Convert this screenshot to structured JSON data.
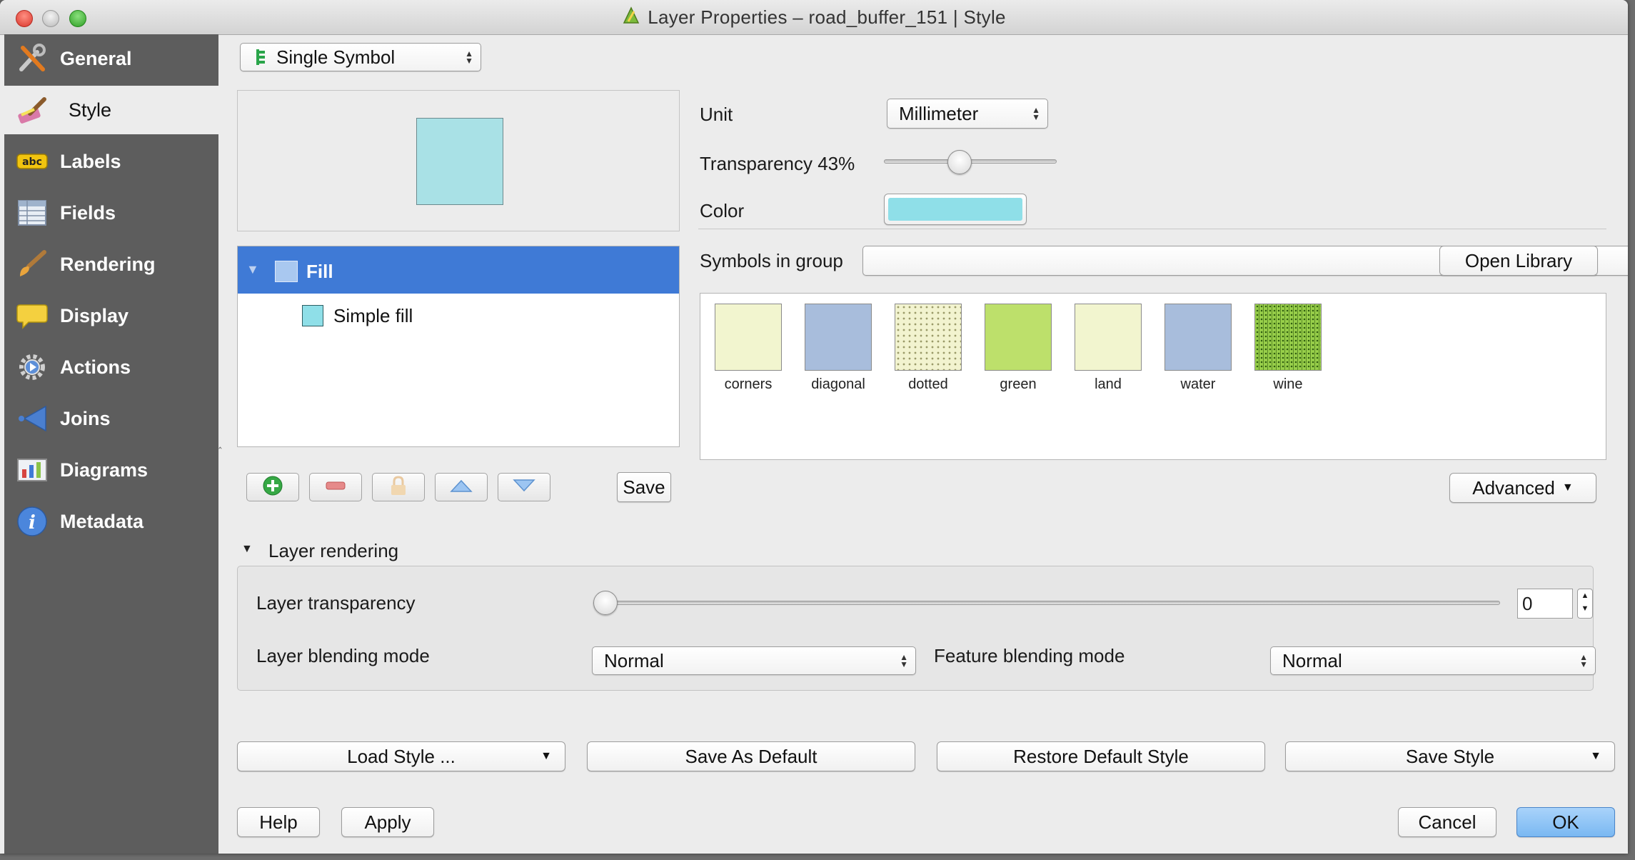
{
  "window": {
    "title": "Layer Properties – road_buffer_151 | Style"
  },
  "sidebar": {
    "items": [
      {
        "label": "General",
        "icon": "general-tools-icon"
      },
      {
        "label": "Style",
        "icon": "style-paintbrush-icon",
        "active": true
      },
      {
        "label": "Labels",
        "icon": "labels-abc-icon",
        "badge": "abc"
      },
      {
        "label": "Fields",
        "icon": "fields-table-icon"
      },
      {
        "label": "Rendering",
        "icon": "rendering-brush-icon"
      },
      {
        "label": "Display",
        "icon": "display-speech-bubble-icon"
      },
      {
        "label": "Actions",
        "icon": "actions-gear-icon"
      },
      {
        "label": "Joins",
        "icon": "joins-arrow-icon"
      },
      {
        "label": "Diagrams",
        "icon": "diagrams-icon"
      },
      {
        "label": "Metadata",
        "icon": "metadata-info-icon",
        "badge": "i"
      }
    ]
  },
  "renderer": {
    "selected": "Single Symbol"
  },
  "symbol_tree": {
    "fill_label": "Fill",
    "simple_fill_label": "Simple fill"
  },
  "tree_toolbar": {
    "save_label": "Save"
  },
  "symbol_props": {
    "unit_label": "Unit",
    "unit_value": "Millimeter",
    "transparency_label": "Transparency 43%",
    "transparency_value": 0.43,
    "color_label": "Color",
    "color_value": "#8fdfe8"
  },
  "library": {
    "group_label": "Symbols in group",
    "group_value": "",
    "open_library_label": "Open Library",
    "symbols": [
      {
        "name": "corners",
        "color": "#f2f5cf"
      },
      {
        "name": "diagonal",
        "color": "#a8bddc"
      },
      {
        "name": "dotted",
        "color": "#f2f3cf"
      },
      {
        "name": "green",
        "color": "#bde06b"
      },
      {
        "name": "land",
        "color": "#f2f5cf"
      },
      {
        "name": "water",
        "color": "#a8bddc"
      },
      {
        "name": "wine",
        "color": "#98cf4a"
      }
    ],
    "advanced_label": "Advanced"
  },
  "layer_rendering": {
    "section_label": "Layer rendering",
    "transparency_label": "Layer transparency",
    "transparency_value": "0",
    "blending_label": "Layer blending mode",
    "blending_value": "Normal",
    "feature_blending_label": "Feature blending mode",
    "feature_blending_value": "Normal"
  },
  "style_buttons": {
    "load": "Load Style ...",
    "save_default": "Save As Default",
    "restore_default": "Restore Default Style",
    "save_style": "Save Style"
  },
  "dialog_buttons": {
    "help": "Help",
    "apply": "Apply",
    "cancel": "Cancel",
    "ok": "OK"
  },
  "colors": {
    "selection": "#3f7ad6",
    "ok_button": "#7ab8f2",
    "sidebar": "#5d5d5d",
    "preview_fill": "#a9e1e6"
  }
}
